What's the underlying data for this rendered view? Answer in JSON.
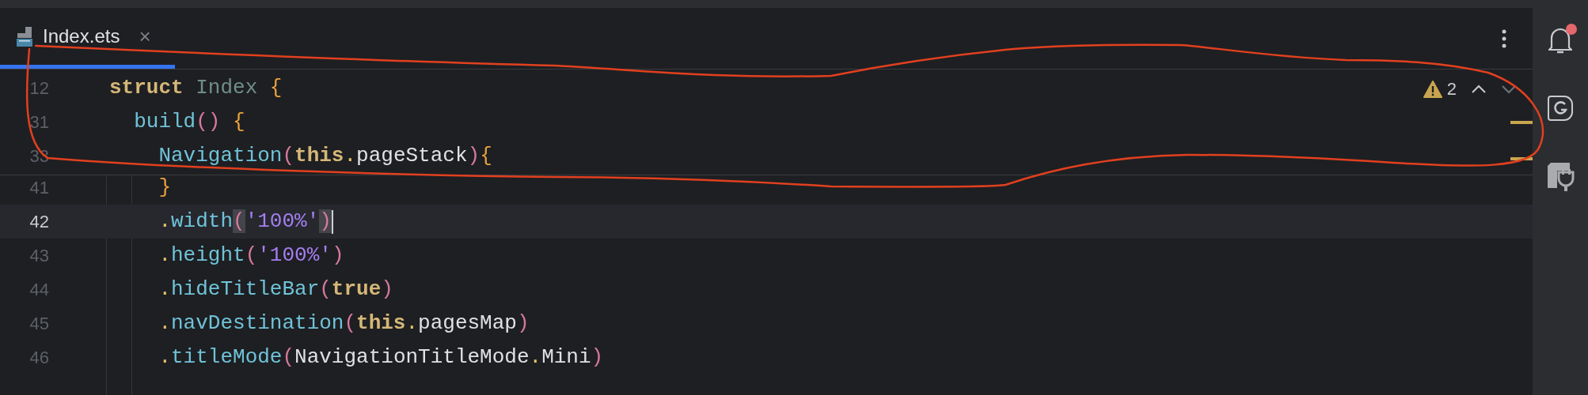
{
  "tab": {
    "title": "Index.ets",
    "selected": true,
    "close": "×"
  },
  "sticky_lines": [
    {
      "number": "12",
      "tokens": [
        {
          "kind": "keyword",
          "text": "struct "
        },
        {
          "kind": "type",
          "text": "Index "
        },
        {
          "kind": "brace",
          "text": "{"
        }
      ]
    },
    {
      "number": "31",
      "tokens": [
        {
          "kind": "function",
          "text": "  build"
        },
        {
          "kind": "paren",
          "text": "() "
        },
        {
          "kind": "brace",
          "text": "{"
        }
      ]
    },
    {
      "number": "33",
      "tokens": [
        {
          "kind": "function",
          "text": "    Navigation"
        },
        {
          "kind": "paren",
          "text": "("
        },
        {
          "kind": "keyword",
          "text": "this"
        },
        {
          "kind": "dot",
          "text": "."
        },
        {
          "kind": "plain",
          "text": "pageStack"
        },
        {
          "kind": "paren",
          "text": ")"
        },
        {
          "kind": "brace",
          "text": "{"
        }
      ]
    }
  ],
  "lines": [
    {
      "number": "41",
      "current": false,
      "tokens": [
        {
          "kind": "brace",
          "text": "    }"
        }
      ]
    },
    {
      "number": "42",
      "current": true,
      "tokens": [
        {
          "kind": "dot",
          "text": "    ."
        },
        {
          "kind": "function",
          "text": "width"
        },
        {
          "kind": "paren",
          "text": "(",
          "matched": true
        },
        {
          "kind": "string",
          "text": "'100%'"
        },
        {
          "kind": "paren",
          "text": ")",
          "matched": true
        }
      ]
    },
    {
      "number": "43",
      "current": false,
      "tokens": [
        {
          "kind": "dot",
          "text": "    ."
        },
        {
          "kind": "function",
          "text": "height"
        },
        {
          "kind": "paren",
          "text": "("
        },
        {
          "kind": "string",
          "text": "'100%'"
        },
        {
          "kind": "paren",
          "text": ")"
        }
      ]
    },
    {
      "number": "44",
      "current": false,
      "tokens": [
        {
          "kind": "dot",
          "text": "    ."
        },
        {
          "kind": "function",
          "text": "hideTitleBar"
        },
        {
          "kind": "paren",
          "text": "("
        },
        {
          "kind": "keyword",
          "text": "true"
        },
        {
          "kind": "paren",
          "text": ")"
        }
      ]
    },
    {
      "number": "45",
      "current": false,
      "tokens": [
        {
          "kind": "dot",
          "text": "    ."
        },
        {
          "kind": "function",
          "text": "navDestination"
        },
        {
          "kind": "paren",
          "text": "("
        },
        {
          "kind": "keyword",
          "text": "this"
        },
        {
          "kind": "dot",
          "text": "."
        },
        {
          "kind": "plain",
          "text": "pagesMap"
        },
        {
          "kind": "paren",
          "text": ")"
        }
      ]
    },
    {
      "number": "46",
      "current": false,
      "tokens": [
        {
          "kind": "dot",
          "text": "    ."
        },
        {
          "kind": "function",
          "text": "titleMode"
        },
        {
          "kind": "paren",
          "text": "("
        },
        {
          "kind": "plain",
          "text": "NavigationTitleMode"
        },
        {
          "kind": "dot",
          "text": "."
        },
        {
          "kind": "plain",
          "text": "Mini"
        },
        {
          "kind": "paren",
          "text": ")"
        }
      ]
    }
  ],
  "inspection": {
    "warnings": "2"
  },
  "notifications": {
    "unread": true
  }
}
